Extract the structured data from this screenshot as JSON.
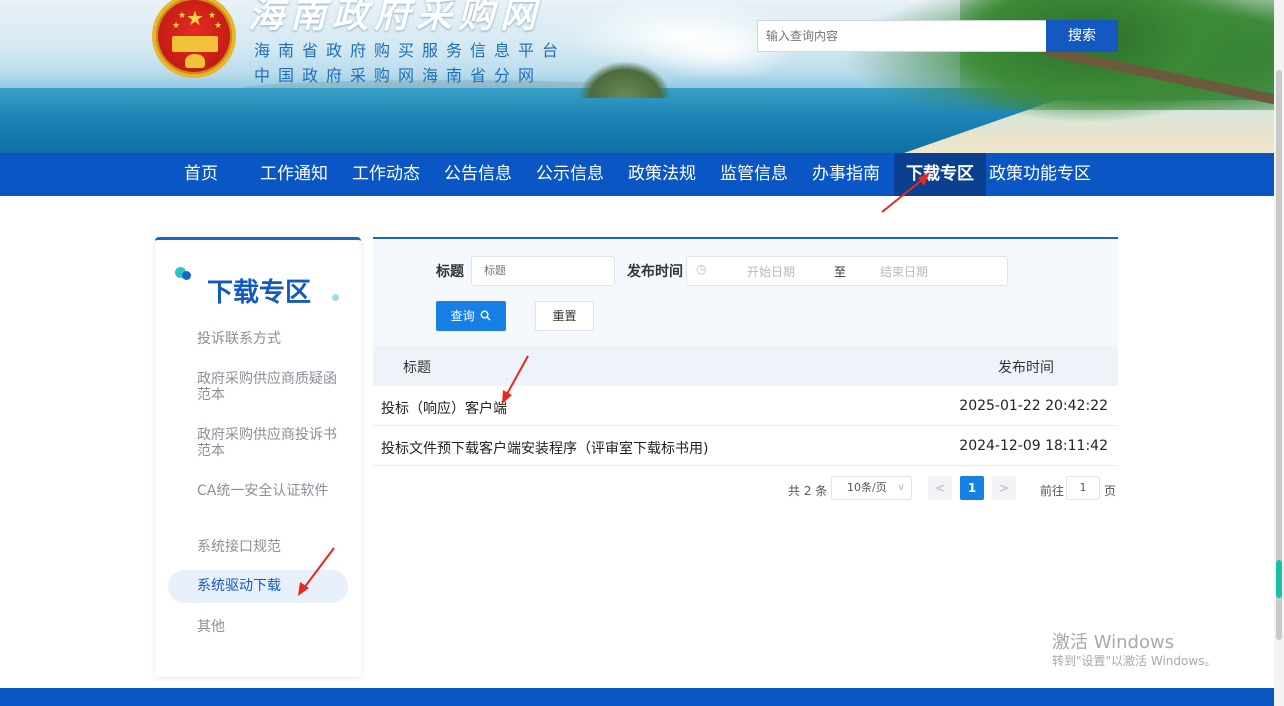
{
  "header": {
    "site_title": "海南政府采购网",
    "subtitle_1": "海南省政府购买服务信息平台",
    "subtitle_2": "中国政府采购网海南省分网",
    "search_placeholder": "输入查询内容",
    "search_button": "搜索"
  },
  "nav": {
    "items": [
      "首页",
      "工作通知",
      "工作动态",
      "公告信息",
      "公示信息",
      "政策法规",
      "监管信息",
      "办事指南",
      "下载专区",
      "政策功能专区"
    ],
    "active_index": 8
  },
  "sidebar": {
    "title": "下载专区",
    "items": [
      {
        "label": "投诉联系方式"
      },
      {
        "label": "政府采购供应商质疑函范本"
      },
      {
        "label": "政府采购供应商投诉书范本"
      },
      {
        "label": "CA统一安全认证软件"
      },
      {
        "label": "系统接口规范"
      },
      {
        "label": "系统驱动下载"
      },
      {
        "label": "其他"
      }
    ],
    "active_index": 5
  },
  "filter": {
    "title_label": "标题",
    "title_placeholder": "标题",
    "date_label": "发布时间",
    "start_placeholder": "开始日期",
    "separator": "至",
    "end_placeholder": "结束日期",
    "query_button": "查询",
    "reset_button": "重置"
  },
  "table": {
    "headers": [
      "标题",
      "发布时间"
    ],
    "rows": [
      {
        "title": "投标（响应）客户端",
        "time": "2025-01-22 20:42:22"
      },
      {
        "title": "投标文件预下载客户端安装程序（评审室下载标书用)",
        "time": "2024-12-09 18:11:42"
      }
    ]
  },
  "pagination": {
    "total": "共 2 条",
    "page_size": "10条/页",
    "current_page": "1",
    "goto_label": "前往",
    "goto_value": "1",
    "page_suffix": "页"
  },
  "watermark": {
    "line1": "激活 Windows",
    "line2": "转到\"设置\"以激活 Windows。"
  },
  "colors": {
    "primary": "#0a56c4",
    "accent": "#1680e6",
    "annotation_arrow": "#e6281e"
  }
}
